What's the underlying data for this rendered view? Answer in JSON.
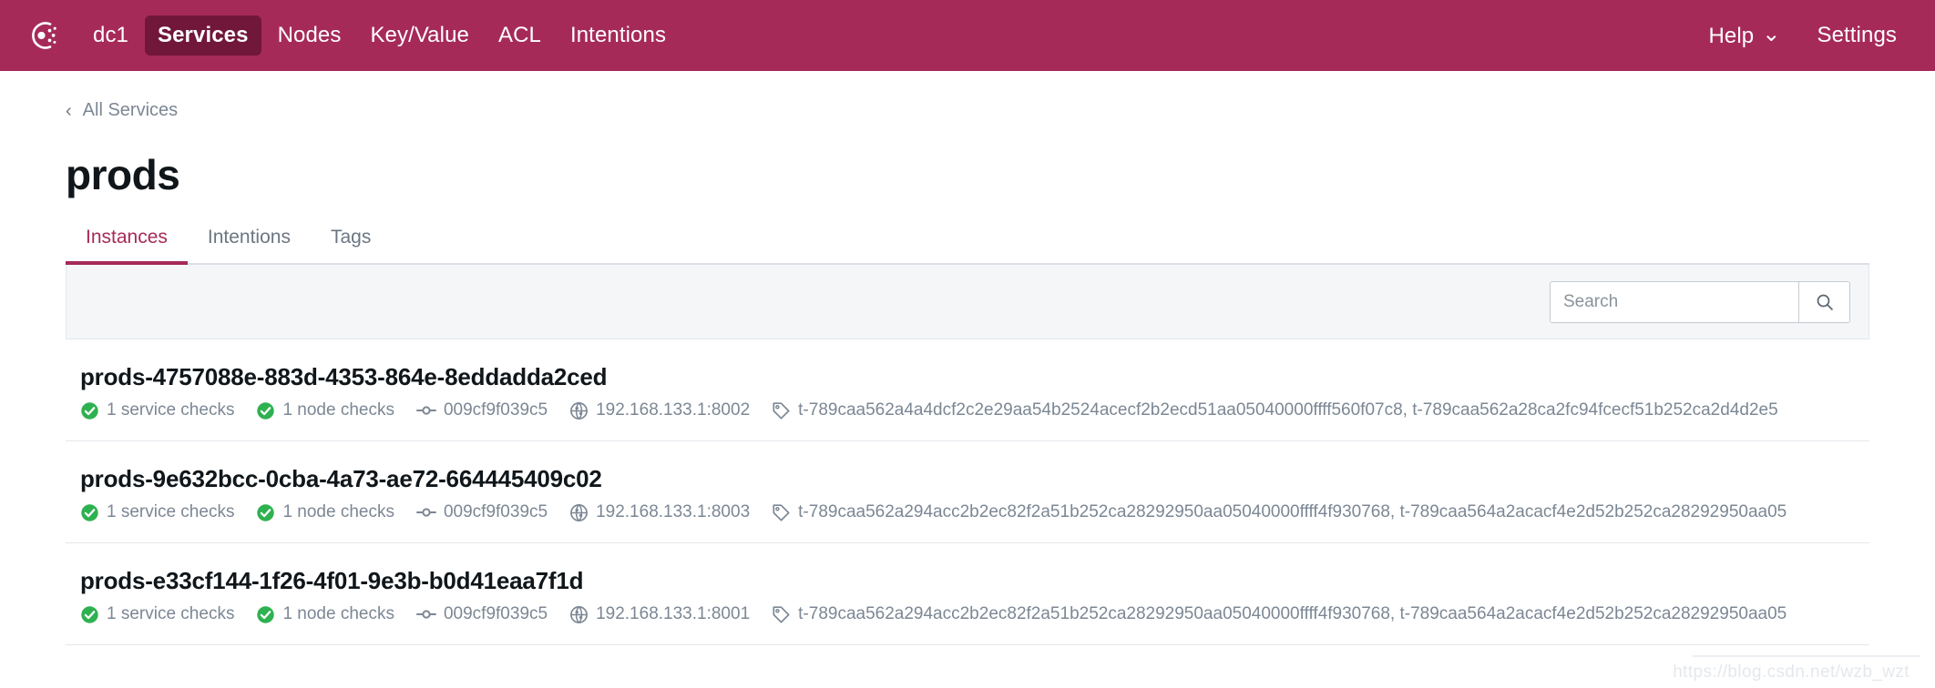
{
  "theme": {
    "brand_color": "#a62a58",
    "brand_active_bg": "#70173a",
    "accent_color": "#a62a58",
    "status_ok_color": "#2eb150",
    "muted_text": "#7c8794"
  },
  "topnav": {
    "logo_name": "consul-logo",
    "items": [
      {
        "label": "dc1",
        "name": "nav-datacenter",
        "active": false
      },
      {
        "label": "Services",
        "name": "nav-services",
        "active": true
      },
      {
        "label": "Nodes",
        "name": "nav-nodes",
        "active": false
      },
      {
        "label": "Key/Value",
        "name": "nav-key-value",
        "active": false
      },
      {
        "label": "ACL",
        "name": "nav-acl",
        "active": false
      },
      {
        "label": "Intentions",
        "name": "nav-intentions",
        "active": false
      }
    ],
    "right_items": [
      {
        "label": "Help",
        "name": "nav-help",
        "has_caret": true
      },
      {
        "label": "Settings",
        "name": "nav-settings",
        "has_caret": false
      }
    ],
    "caret_glyph": "⌄"
  },
  "breadcrumb": {
    "chevron_glyph": "‹",
    "label": "All Services"
  },
  "page": {
    "title": "prods"
  },
  "tabs": [
    {
      "label": "Instances",
      "active": true
    },
    {
      "label": "Intentions",
      "active": false
    },
    {
      "label": "Tags",
      "active": false
    }
  ],
  "search": {
    "value": "",
    "placeholder": "Search",
    "button_icon": "search-icon"
  },
  "instances": [
    {
      "name": "prods-4757088e-883d-4353-864e-8eddadda2ced",
      "service_checks": "1 service checks",
      "node_checks": "1 node checks",
      "node_id": "009cf9f039c5",
      "address": "192.168.133.1:8002",
      "tags": "t-789caa562a4a4dcf2c2e29aa54b2524acecf2b2ecd51aa05040000ffff560f07c8, t-789caa562a28ca2fc94fcecf51b252ca2d4d2e5"
    },
    {
      "name": "prods-9e632bcc-0cba-4a73-ae72-664445409c02",
      "service_checks": "1 service checks",
      "node_checks": "1 node checks",
      "node_id": "009cf9f039c5",
      "address": "192.168.133.1:8003",
      "tags": "t-789caa562a294acc2b2ec82f2a51b252ca28292950aa05040000ffff4f930768, t-789caa564a2acacf4e2d52b252ca28292950aa05"
    },
    {
      "name": "prods-e33cf144-1f26-4f01-9e3b-b0d41eaa7f1d",
      "service_checks": "1 service checks",
      "node_checks": "1 node checks",
      "node_id": "009cf9f039c5",
      "address": "192.168.133.1:8001",
      "tags": "t-789caa562a294acc2b2ec82f2a51b252ca28292950aa05040000ffff4f930768, t-789caa564a2acacf4e2d52b252ca28292950aa05"
    }
  ],
  "watermark": {
    "text": "https://blog.csdn.net/wzb_wzt"
  }
}
